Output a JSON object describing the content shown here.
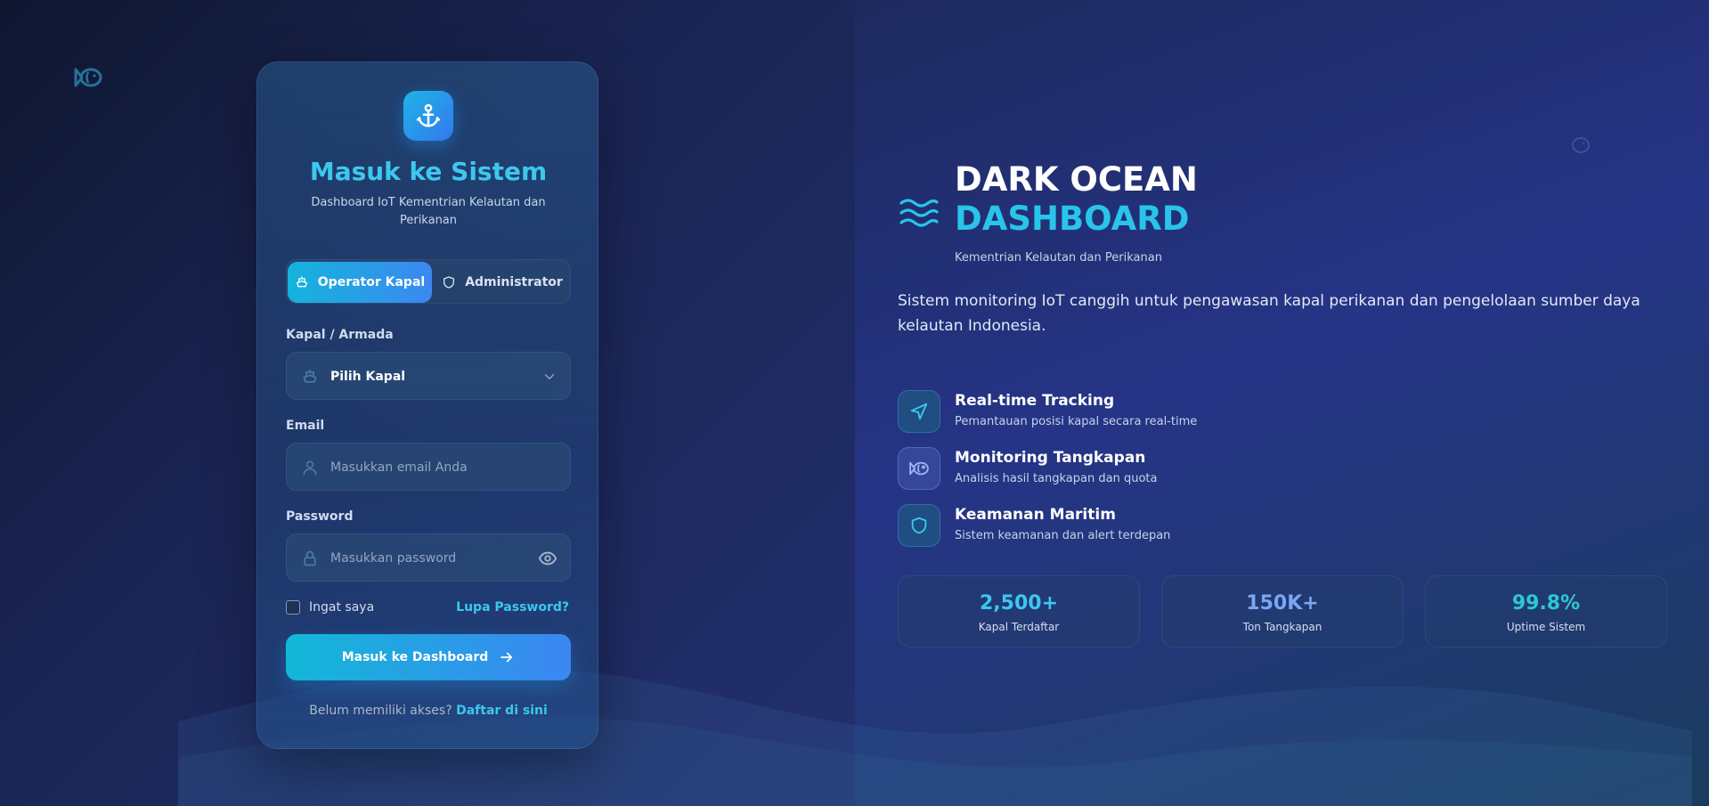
{
  "login": {
    "title": "Masuk ke Sistem",
    "subtitle": "Dashboard IoT Kementrian Kelautan dan Perikanan",
    "roles": [
      {
        "label": "Operator Kapal",
        "active": true
      },
      {
        "label": "Administrator",
        "active": false
      }
    ],
    "vessel_label": "Kapal / Armada",
    "vessel_value": "Pilih Kapal",
    "email_label": "Email",
    "email_placeholder": "Masukkan email Anda",
    "password_label": "Password",
    "password_placeholder": "Masukkan password",
    "remember_label": "Ingat saya",
    "forgot_label": "Lupa Password?",
    "submit_label": "Masuk ke Dashboard",
    "register_text": "Belum memiliki akses?",
    "register_link": "Daftar di sini"
  },
  "brand": {
    "title_line1": "DARK OCEAN",
    "title_line2": "DASHBOARD",
    "subtitle": "Kementrian Kelautan dan Perikanan",
    "description": "Sistem monitoring IoT canggih untuk pengawasan kapal perikanan dan pengelolaan sumber daya kelautan Indonesia."
  },
  "features": [
    {
      "icon": "navigation-icon",
      "title": "Real-time Tracking",
      "desc": "Pemantauan posisi kapal secara real-time"
    },
    {
      "icon": "fish-icon",
      "title": "Monitoring Tangkapan",
      "desc": "Analisis hasil tangkapan dan quota"
    },
    {
      "icon": "shield-icon",
      "title": "Keamanan Maritim",
      "desc": "Sistem keamanan dan alert terdepan"
    }
  ],
  "stats": [
    {
      "value": "2,500+",
      "label": "Kapal Terdaftar",
      "color": "#3cc8ee"
    },
    {
      "value": "150K+",
      "label": "Ton Tangkapan",
      "color": "#7aa6f4"
    },
    {
      "value": "99.8%",
      "label": "Uptime Sistem",
      "color": "#2ec6d6"
    }
  ],
  "colors": {
    "accent_cyan": "#3cc8ee",
    "accent_blue": "#3c86f2",
    "title_cyan": "#29c4ea"
  }
}
